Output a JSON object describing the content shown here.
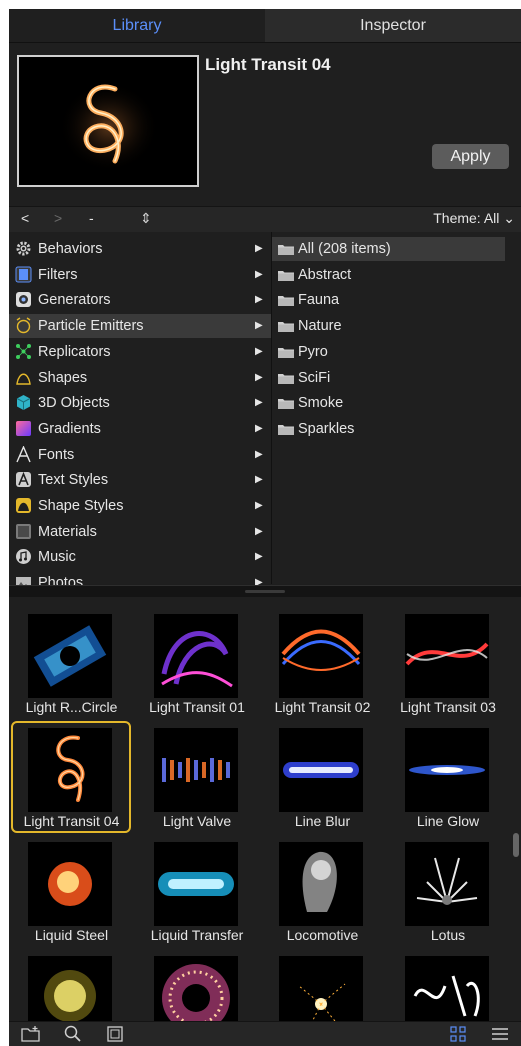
{
  "tabs": [
    {
      "label": "Library",
      "active": true
    },
    {
      "label": "Inspector",
      "active": false
    }
  ],
  "preview": {
    "title": "Light Transit 04",
    "apply_label": "Apply"
  },
  "nav": {
    "back": "<",
    "forward": ">",
    "path": "-",
    "theme": "Theme: All"
  },
  "categories": [
    {
      "label": "Behaviors",
      "icon": "gear-icon",
      "color": "#cfcfcf"
    },
    {
      "label": "Filters",
      "icon": "film-icon",
      "color": "#5b8ff9"
    },
    {
      "label": "Generators",
      "icon": "generator-icon",
      "color": "#8a8a8a"
    },
    {
      "label": "Particle Emitters",
      "icon": "alarm-clock-icon",
      "color": "#e4b82b",
      "selected": true
    },
    {
      "label": "Replicators",
      "icon": "replicator-icon",
      "color": "#3ecf5e"
    },
    {
      "label": "Shapes",
      "icon": "shape-icon",
      "color": "#e4b82b"
    },
    {
      "label": "3D Objects",
      "icon": "cube-icon",
      "color": "#2fb3c8"
    },
    {
      "label": "Gradients",
      "icon": "gradient-icon",
      "color": "#d04a7a"
    },
    {
      "label": "Fonts",
      "icon": "font-icon",
      "color": "#e6e6e6"
    },
    {
      "label": "Text Styles",
      "icon": "text-style-icon",
      "color": "#cfcfcf"
    },
    {
      "label": "Shape Styles",
      "icon": "shape-style-icon",
      "color": "#e4b82b"
    },
    {
      "label": "Materials",
      "icon": "materials-icon",
      "color": "#7a7a7a"
    },
    {
      "label": "Music",
      "icon": "music-icon",
      "color": "#cfcfcf"
    },
    {
      "label": "Photos",
      "icon": "photos-icon",
      "color": "#8a8a8a"
    }
  ],
  "folders": [
    {
      "label": "All (208 items)",
      "selected": true
    },
    {
      "label": "Abstract"
    },
    {
      "label": "Fauna"
    },
    {
      "label": "Nature"
    },
    {
      "label": "Pyro"
    },
    {
      "label": "SciFi"
    },
    {
      "label": "Smoke"
    },
    {
      "label": "Sparkles"
    }
  ],
  "items": [
    {
      "label": "Light R...Circle",
      "palette": [
        "#1a6fd1",
        "#5ad3ff"
      ]
    },
    {
      "label": "Light Transit 01",
      "palette": [
        "#8a3dff",
        "#ff4fd8"
      ]
    },
    {
      "label": "Light Transit 02",
      "palette": [
        "#ff6a2b",
        "#3a6bff"
      ]
    },
    {
      "label": "Light Transit 03",
      "palette": [
        "#ff3b3b",
        "#e8e8e8"
      ]
    },
    {
      "label": "Light Transit 04",
      "palette": [
        "#ff8a3d",
        "#ffd5a0"
      ],
      "selected": true
    },
    {
      "label": "Light Valve",
      "palette": [
        "#ff7a2b",
        "#6a7bff"
      ]
    },
    {
      "label": "Line Blur",
      "palette": [
        "#3a4dff",
        "#e8ecff"
      ]
    },
    {
      "label": "Line Glow",
      "palette": [
        "#3a6bff",
        "#ffffff"
      ]
    },
    {
      "label": "Liquid Steel",
      "palette": [
        "#ff5a1e",
        "#ffd27a"
      ]
    },
    {
      "label": "Liquid Transfer",
      "palette": [
        "#1aa7d8",
        "#bff0ff"
      ]
    },
    {
      "label": "Locomotive",
      "palette": [
        "#9a9a9a",
        "#e8e8e8"
      ]
    },
    {
      "label": "Lotus",
      "palette": [
        "#e8e8e8",
        "#7a7a7a"
      ]
    },
    {
      "label": "",
      "palette": [
        "#fff27a",
        "#e8d12b"
      ]
    },
    {
      "label": "",
      "palette": [
        "#ff5ab0",
        "#ffd0a0"
      ]
    },
    {
      "label": "",
      "palette": [
        "#ffb03a",
        "#fff2c0"
      ]
    },
    {
      "label": "",
      "palette": [
        "#ffffff",
        "#cfcfcf"
      ]
    }
  ],
  "bottombar": {
    "icons": [
      "new-folder-icon",
      "search-icon",
      "preview-icon",
      "grid-view-icon",
      "list-view-icon"
    ]
  }
}
